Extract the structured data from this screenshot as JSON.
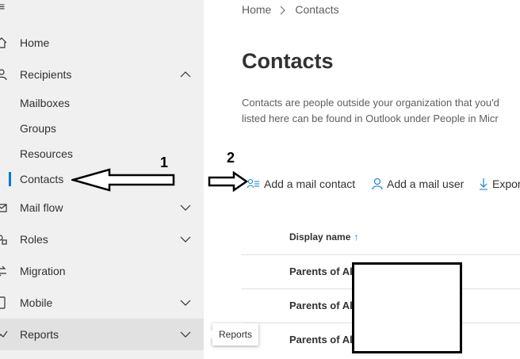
{
  "sidebar": {
    "menu_icon": "hamburger-icon",
    "items": [
      {
        "label": "Home",
        "icon": "home-icon"
      },
      {
        "label": "Recipients",
        "icon": "person-icon",
        "expanded": true
      },
      {
        "label": "Mail flow",
        "icon": "mail-icon"
      },
      {
        "label": "Roles",
        "icon": "roles-icon"
      },
      {
        "label": "Migration",
        "icon": "migration-icon"
      },
      {
        "label": "Mobile",
        "icon": "mobile-icon"
      },
      {
        "label": "Reports",
        "icon": "chart-icon"
      }
    ],
    "recipients_sub": [
      "Mailboxes",
      "Groups",
      "Resources",
      "Contacts"
    ],
    "active_sub": "Contacts",
    "tooltip": "Reports"
  },
  "breadcrumb": {
    "home": "Home",
    "current": "Contacts"
  },
  "page": {
    "title": "Contacts",
    "description_line1": "Contacts are people outside your organization that you'd",
    "description_line2": "listed here can be found in Outlook under People in Micr"
  },
  "commands": {
    "add_mail_contact": "Add a mail contact",
    "add_mail_user": "Add a mail user",
    "export": "Expor"
  },
  "table": {
    "header": "Display name",
    "sort_indicator": "↑",
    "rows": [
      "Parents of Al",
      "Parents of Al",
      "Parents of Al"
    ]
  },
  "annotations": {
    "step1": "1",
    "step2": "2"
  },
  "colors": {
    "accent": "#0078d4",
    "sidebar_bg": "#f0f0f0"
  }
}
